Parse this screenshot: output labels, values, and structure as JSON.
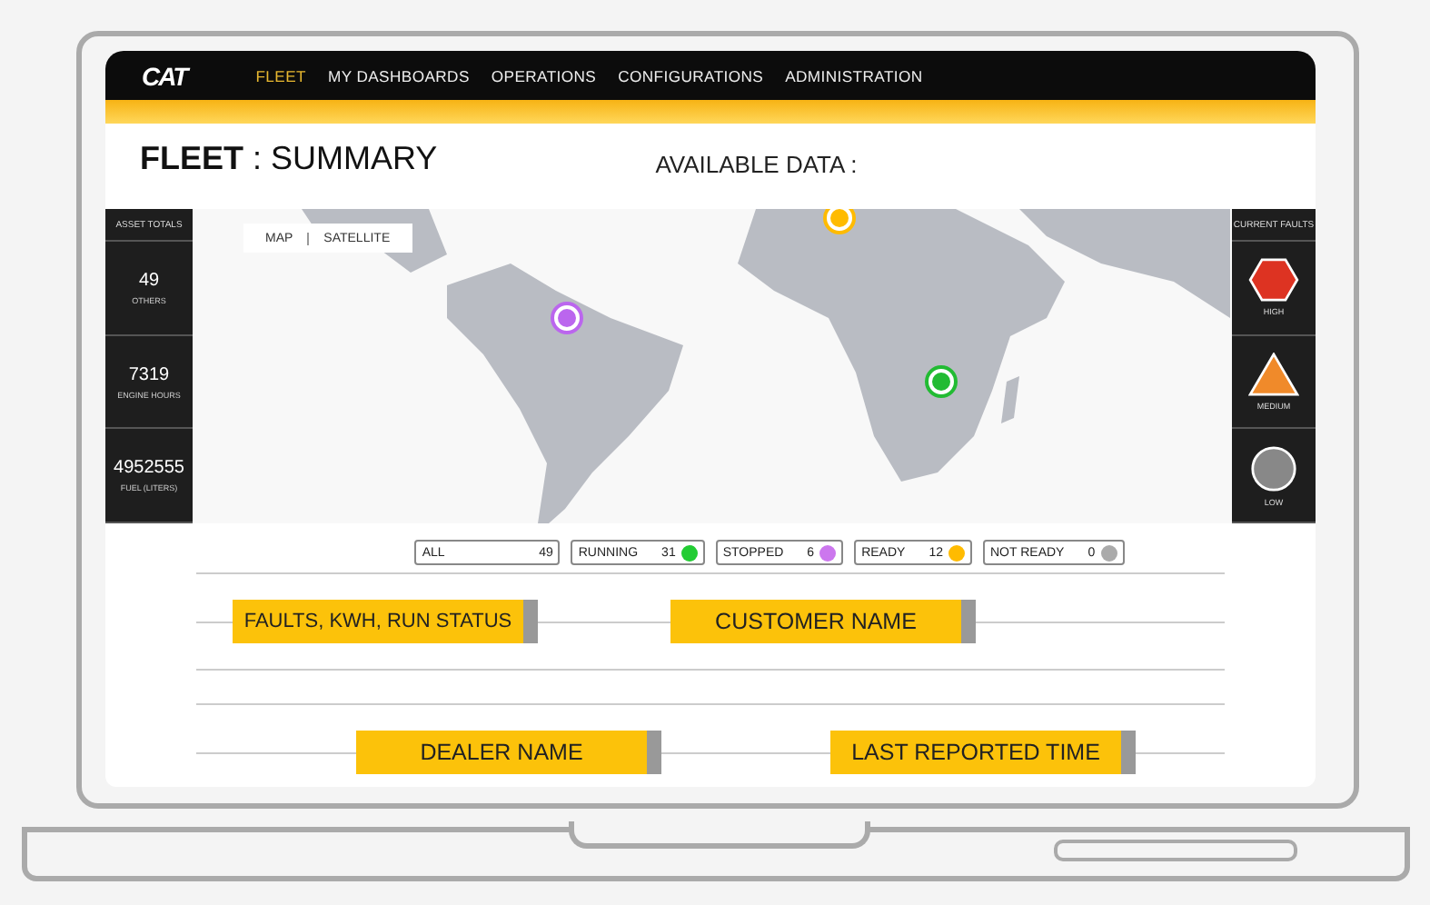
{
  "nav": {
    "logo": "CAT",
    "items": [
      {
        "label": "FLEET",
        "selected": true
      },
      {
        "label": "MY DASHBOARDS",
        "selected": false
      },
      {
        "label": "OPERATIONS",
        "selected": false
      },
      {
        "label": "CONFIGURATIONS",
        "selected": false
      },
      {
        "label": "ADMINISTRATION",
        "selected": false
      }
    ]
  },
  "header": {
    "title": "FLEET",
    "separator": ":",
    "subtitle": "SUMMARY",
    "available_data": "AVAILABLE DATA :"
  },
  "asset_totals": {
    "title": "ASSET TOTALS",
    "items": [
      {
        "value": "49",
        "label": "OTHERS"
      },
      {
        "value": "7319",
        "label": "ENGINE HOURS"
      },
      {
        "value": "4952555",
        "label": "FUEL (LITERS)"
      }
    ]
  },
  "map_toggle": [
    "MAP",
    "SATELLITE"
  ],
  "current_faults": {
    "title": "CURRENT FAULTS",
    "items": [
      {
        "kind": "high",
        "label": "HIGH"
      },
      {
        "kind": "medium",
        "label": "MEDIUM"
      },
      {
        "kind": "low",
        "label": "LOW"
      }
    ]
  },
  "filters": [
    {
      "label": "ALL",
      "count": "49"
    },
    {
      "label": "RUNNING",
      "count": "31",
      "color": "#22cc33"
    },
    {
      "label": "STOPPED",
      "count": "6",
      "color": "#cc77ee"
    },
    {
      "label": "READY",
      "count": "12",
      "color": "#ffbb00"
    },
    {
      "label": "NOT READY",
      "count": "0",
      "color": "#aaaaaa"
    }
  ],
  "data_tags": [
    [
      "FAULTS, KWH, RUN STATUS",
      "CUSTOMER NAME"
    ],
    [
      "DEALER NAME",
      "LAST REPORTED TIME"
    ]
  ]
}
